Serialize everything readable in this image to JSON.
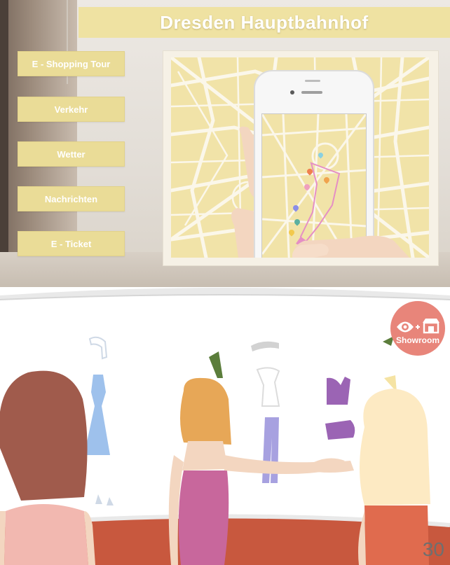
{
  "header": {
    "title": "Dresden Hauptbahnhof"
  },
  "menu": {
    "items": [
      {
        "label": "E - Shopping Tour"
      },
      {
        "label": "Verkehr"
      },
      {
        "label": "Wetter"
      },
      {
        "label": "Nachrichten"
      },
      {
        "label": "E - Ticket"
      }
    ]
  },
  "showroom": {
    "label": "Showroom",
    "icon": "eye-plus-store-icon"
  },
  "page": {
    "number": "30"
  },
  "colors": {
    "menu_button": "#eadc97",
    "title_bar": "#efe2a2",
    "map_base": "#f1e3a8",
    "route": "#e58fc4",
    "badge": "#e8857a",
    "floor": "#c8583e"
  }
}
